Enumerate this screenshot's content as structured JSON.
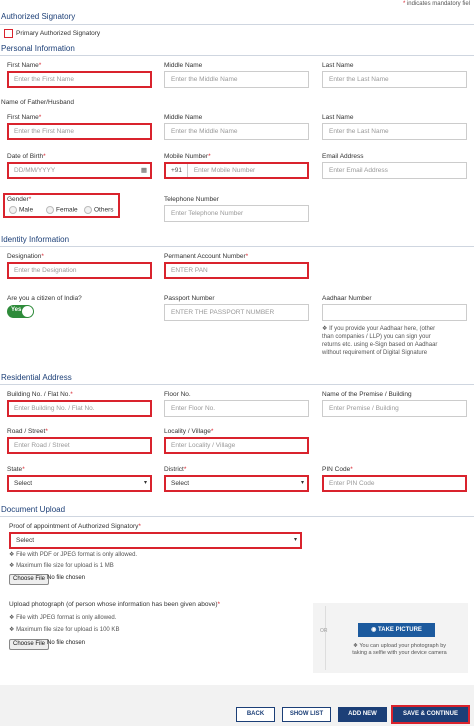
{
  "mandatory_note": "indicates mandatory fiel",
  "authorized_signatory": {
    "title": "Authorized Signatory",
    "primary_label": "Primary Authorized Signatory"
  },
  "personal": {
    "title": "Personal Information",
    "first_name": {
      "label": "First Name",
      "placeholder": "Enter the First Name"
    },
    "middle_name": {
      "label": "Middle Name",
      "placeholder": "Enter the Middle Name"
    },
    "last_name": {
      "label": "Last Name",
      "placeholder": "Enter the Last Name"
    },
    "father_heading": "Name of Father/Husband",
    "father_first": {
      "label": "First Name",
      "placeholder": "Enter the First Name"
    },
    "father_middle": {
      "label": "Middle Name",
      "placeholder": "Enter the Middle Name"
    },
    "father_last": {
      "label": "Last Name",
      "placeholder": "Enter the Last Name"
    },
    "dob": {
      "label": "Date of Birth",
      "placeholder": "DD/MM/YYYY"
    },
    "mobile": {
      "label": "Mobile Number",
      "prefix": "+91",
      "placeholder": "Enter Mobile Number"
    },
    "email": {
      "label": "Email Address",
      "placeholder": "Enter Email Address"
    },
    "gender": {
      "label": "Gender",
      "options": [
        "Male",
        "Female",
        "Others"
      ]
    },
    "telephone": {
      "label": "Telephone Number",
      "placeholder": "Enter Telephone Number"
    }
  },
  "identity": {
    "title": "Identity Information",
    "designation": {
      "label": "Designation",
      "placeholder": "Enter the Designation"
    },
    "pan": {
      "label": "Permanent Account Number",
      "placeholder": "ENTER PAN"
    },
    "citizen": {
      "label": "Are you a citizen of India?",
      "toggle": "Yes"
    },
    "passport": {
      "label": "Passport Number",
      "placeholder": "ENTER THE PASSPORT NUMBER"
    },
    "aadhaar": {
      "label": "Aadhaar Number",
      "placeholder": "",
      "note_lines": [
        "If you provide your Aadhaar here, (other",
        "than companies / LLP) you can sign your",
        "returns etc. using e-Sign based on Aadhaar",
        "without requirement of Digital Signature"
      ]
    }
  },
  "residential": {
    "title": "Residential Address",
    "building": {
      "label": "Building No. / Flat No.",
      "placeholder": "Enter Building No. / Flat No."
    },
    "floor": {
      "label": "Floor No.",
      "placeholder": "Enter Floor No."
    },
    "premise": {
      "label": "Name of the Premise / Building",
      "placeholder": "Enter Premise / Building"
    },
    "road": {
      "label": "Road / Street",
      "placeholder": "Enter Road / Street"
    },
    "locality": {
      "label": "Locality / Village",
      "placeholder": "Enter Locality / Village"
    },
    "state": {
      "label": "State",
      "value": "Select"
    },
    "district": {
      "label": "District",
      "value": "Select"
    },
    "pin": {
      "label": "PIN Code",
      "placeholder": "Enter PIN Code"
    }
  },
  "upload": {
    "title": "Document Upload",
    "proof_label": "Proof of appointment of Authorized Signatory",
    "proof_value": "Select",
    "proof_note1": "File with PDF or JPEG format is only allowed.",
    "proof_note2": "Maximum file size for upload is 1 MB",
    "choose_file": "Choose File",
    "no_file": "No file chosen",
    "photo_label": "Upload photograph (of person whose information has been given above)",
    "photo_note1": "File with JPEG format is only allowed.",
    "photo_note2": "Maximum file size for upload is 100 KB",
    "photo_choose": "Choose File",
    "photo_no_file": "No file chosen",
    "or": "OR",
    "take_picture": "TAKE PICTURE",
    "camera_note_lines": [
      "You can upload your photograph by",
      "taking a selfie with your device camera"
    ]
  },
  "footer": {
    "back": "BACK",
    "show_list": "SHOW LIST",
    "add_new": "ADD NEW",
    "save": "SAVE & CONTINUE"
  },
  "colors": {
    "accent": "#1c3f77",
    "error": "#d9232d",
    "toggle": "#2e8b3a"
  }
}
